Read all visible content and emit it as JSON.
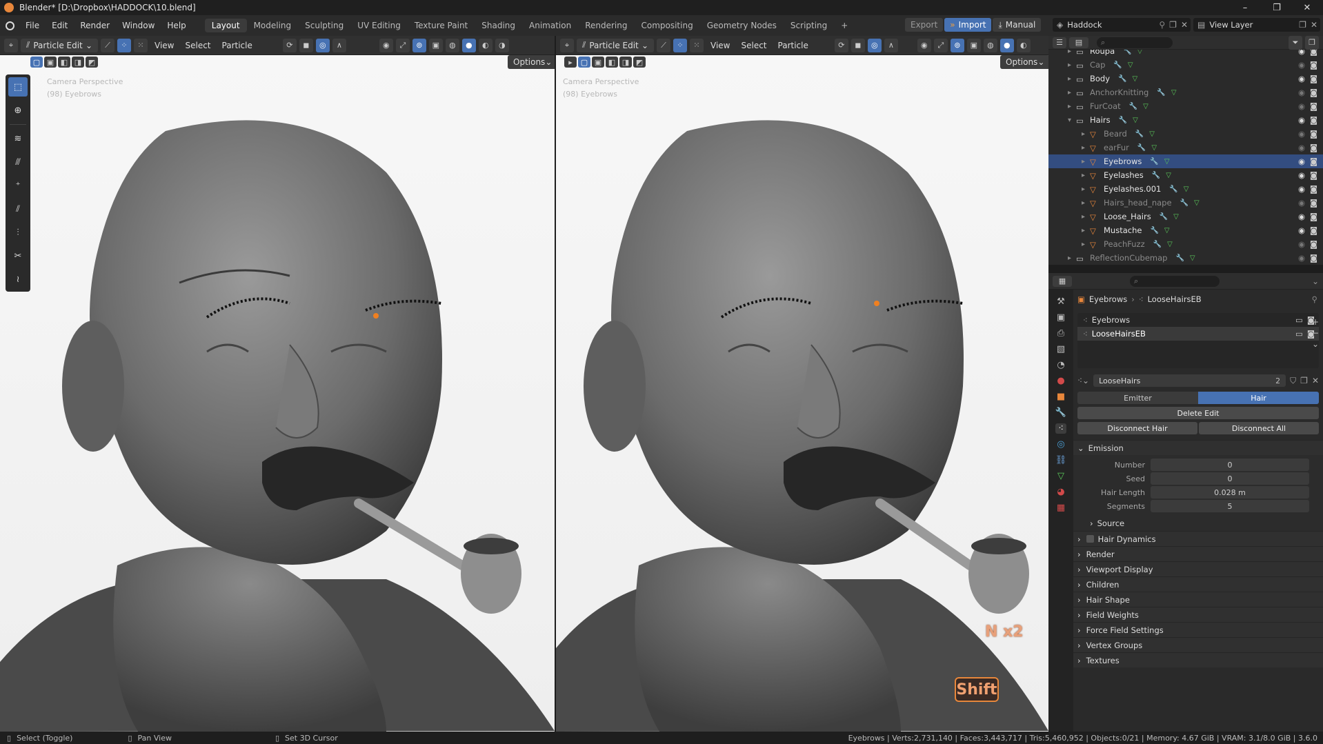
{
  "window": {
    "title": "Blender* [D:\\Dropbox\\HADDOCK\\10.blend]"
  },
  "menus": [
    "File",
    "Edit",
    "Render",
    "Window",
    "Help"
  ],
  "workspaces": [
    "Layout",
    "Modeling",
    "Sculpting",
    "UV Editing",
    "Texture Paint",
    "Shading",
    "Animation",
    "Rendering",
    "Compositing",
    "Geometry Nodes",
    "Scripting",
    "+"
  ],
  "active_workspace": "Layout",
  "topright": {
    "export": "Export",
    "import": "Import",
    "manual": "Manual",
    "scene": "Haddock",
    "view_layer": "View Layer"
  },
  "viewport_header": {
    "mode": "Particle Edit",
    "menus": [
      "View",
      "Select",
      "Particle"
    ],
    "options": "Options"
  },
  "viewport_left": {
    "label1": "Camera Perspective",
    "label2": "(98) Eyebrows"
  },
  "viewport_right": {
    "label1": "Camera Perspective",
    "label2": "(98) Eyebrows",
    "key_overlay": "N x2",
    "shift_overlay": "Shift"
  },
  "outliner": {
    "rows": [
      {
        "name": "Roupa",
        "dim": false,
        "indent": 0
      },
      {
        "name": "Cap",
        "dim": true,
        "indent": 0
      },
      {
        "name": "Body",
        "dim": false,
        "indent": 0
      },
      {
        "name": "AnchorKnitting",
        "dim": true,
        "indent": 0
      },
      {
        "name": "FurCoat",
        "dim": true,
        "indent": 0
      },
      {
        "name": "Hairs",
        "dim": false,
        "indent": 0
      },
      {
        "name": "Beard",
        "dim": true,
        "indent": 1
      },
      {
        "name": "earFur",
        "dim": true,
        "indent": 1
      },
      {
        "name": "Eyebrows",
        "dim": false,
        "indent": 1,
        "selected": true
      },
      {
        "name": "Eyelashes",
        "dim": false,
        "indent": 1
      },
      {
        "name": "Eyelashes.001",
        "dim": false,
        "indent": 1
      },
      {
        "name": "Hairs_head_nape",
        "dim": true,
        "indent": 1
      },
      {
        "name": "Loose_Hairs",
        "dim": false,
        "indent": 1
      },
      {
        "name": "Mustache",
        "dim": false,
        "indent": 1
      },
      {
        "name": "PeachFuzz",
        "dim": true,
        "indent": 1
      },
      {
        "name": "ReflectionCubemap",
        "dim": true,
        "indent": 0
      }
    ]
  },
  "properties": {
    "breadcrumb": [
      "Eyebrows",
      "LooseHairsEB"
    ],
    "particle_systems": [
      "Eyebrows",
      "LooseHairsEB"
    ],
    "settings_name": "LooseHairs",
    "settings_users": "2",
    "type_emitter": "Emitter",
    "type_hair": "Hair",
    "delete_edit": "Delete Edit",
    "disconnect_hair": "Disconnect Hair",
    "disconnect_all": "Disconnect All",
    "emission_title": "Emission",
    "emission_fields": [
      {
        "label": "Number",
        "value": "0"
      },
      {
        "label": "Seed",
        "value": "0"
      },
      {
        "label": "Hair Length",
        "value": "0.028 m"
      },
      {
        "label": "Segments",
        "value": "5"
      }
    ],
    "source": "Source",
    "sections": [
      "Hair Dynamics",
      "Render",
      "Viewport Display",
      "Children",
      "Hair Shape",
      "Field Weights",
      "Force Field Settings",
      "Vertex Groups",
      "Textures"
    ]
  },
  "statusbar": {
    "left1": "Select (Toggle)",
    "left2": "Pan View",
    "left3": "Set 3D Cursor",
    "right": "Eyebrows | Verts:2,731,140 | Faces:3,443,717 | Tris:5,460,952 | Objects:0/21 | Memory: 4.67 GiB | VRAM: 3.1/8.0 GiB | 3.6.0"
  }
}
